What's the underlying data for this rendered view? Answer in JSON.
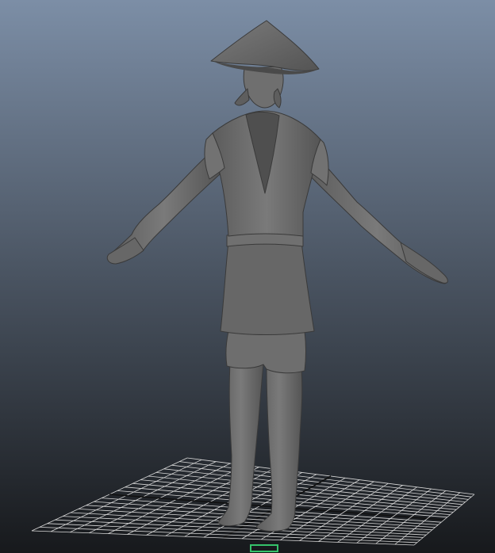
{
  "viewport": {
    "background_top": "#7c8ea6",
    "background_bottom": "#17191c",
    "model_color": "#6a6a6a",
    "grid_color": "#d8d8d8",
    "grid_axis_color": "#111111",
    "manipulator_color": "#35c26a"
  },
  "scene": {
    "model": "character-tpose",
    "grid": true
  }
}
